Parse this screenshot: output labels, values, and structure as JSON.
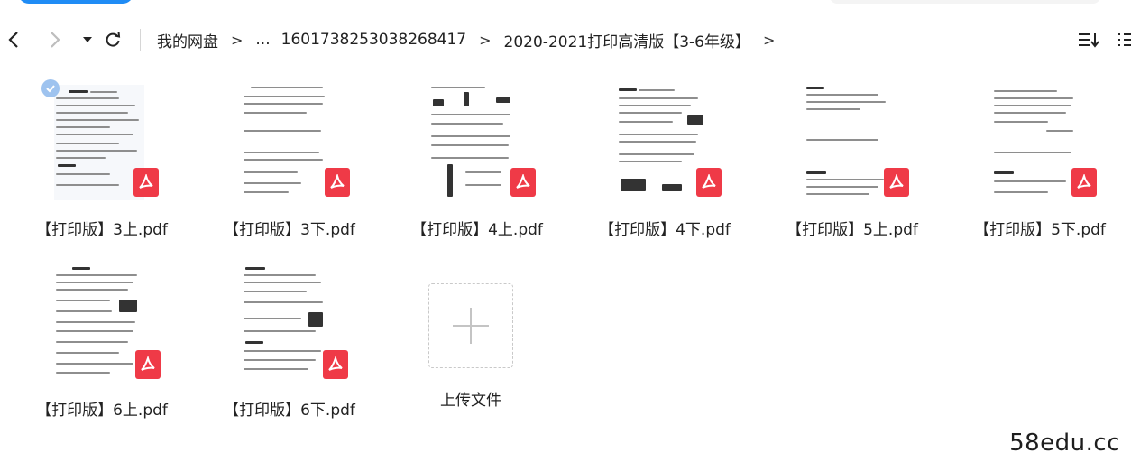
{
  "breadcrumb": {
    "root": "我的网盘",
    "ellipsis": "...",
    "folder_id": "1601738253038268417",
    "folder_name": "2020-2021打印高清版【3-6年级】",
    "separator": ">"
  },
  "files": [
    {
      "name": "【打印版】3上.pdf",
      "selected": true
    },
    {
      "name": "【打印版】3下.pdf",
      "selected": false
    },
    {
      "name": "【打印版】4上.pdf",
      "selected": false
    },
    {
      "name": "【打印版】4下.pdf",
      "selected": false
    },
    {
      "name": "【打印版】5上.pdf",
      "selected": false
    },
    {
      "name": "【打印版】5下.pdf",
      "selected": false
    },
    {
      "name": "【打印版】6上.pdf",
      "selected": false
    },
    {
      "name": "【打印版】6下.pdf",
      "selected": false
    }
  ],
  "upload": {
    "label": "上传文件"
  },
  "watermark": "58edu.cc",
  "colors": {
    "accent": "#1f8cf5",
    "pdf_red": "#ef3a47",
    "check": "#9ec3ef"
  }
}
